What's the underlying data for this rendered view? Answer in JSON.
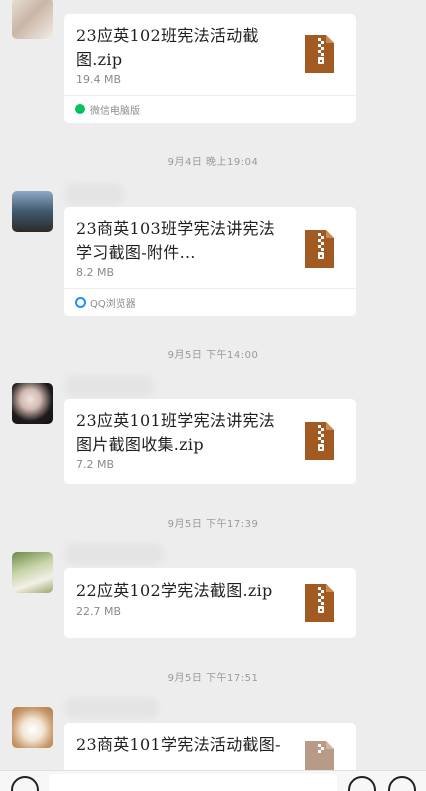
{
  "messages": [
    {
      "file_name": "23应英102班宪法活动截图.zip",
      "size": "19.4 MB",
      "source": "微信电脑版",
      "source_icon": "wechat-icon",
      "source_color": "#07c160"
    },
    {
      "timestamp": "9月4日 晚上19:04",
      "file_name": "23商英103班学宪法讲宪法学习截图-附件…",
      "size": "8.2 MB",
      "source": "QQ浏览器",
      "source_icon": "qq-browser-icon",
      "source_color": "#1e8fff"
    },
    {
      "timestamp": "9月5日 下午14:00",
      "file_name": "23应英101班学宪法讲宪法图片截图收集.zip",
      "size": "7.2 MB"
    },
    {
      "timestamp": "9月5日 下午17:39",
      "file_name": "22应英102学宪法截图.zip",
      "size": "22.7 MB"
    },
    {
      "timestamp": "9月5日 下午17:51",
      "file_name": "23商英101学宪法活动截图-"
    }
  ],
  "colors": {
    "zip_brown": "#a25a23",
    "background": "#ededed"
  }
}
